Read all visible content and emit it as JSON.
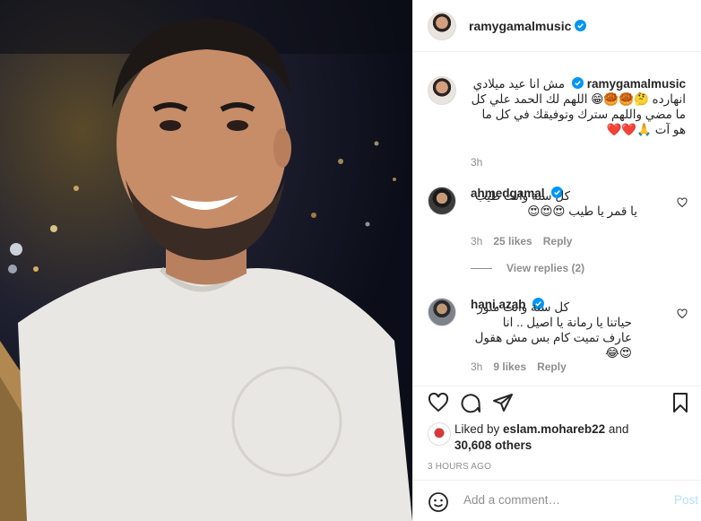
{
  "post": {
    "author": "ramygamalmusic",
    "accent_color": "#0095f6",
    "photo_description_icon": "portrait-photo"
  },
  "caption": {
    "username": "ramygamalmusic",
    "text": "مش انا عيد ميلادي انهارده 🤔🥮🥮😁 اللهم لك الحمد علي كل ما مضي واللهم سترك وتوفيقك في كل ما هو آت 🙏❤️❤️",
    "time": "3h"
  },
  "comments": [
    {
      "username": "ahmedgamal",
      "verified": true,
      "text": "كل سنة وانت طيب يا قمر يا طيب 😍😍😍",
      "time": "3h",
      "likes": "25 likes",
      "reply": "Reply"
    },
    {
      "username": "hani.azab",
      "verified": true,
      "text": "كل سنة وانت منور حياتنا يا رمانة يا اصيل .. انا عارف تميت كام بس مش هقول 😍😂",
      "time": "3h",
      "likes": "9 likes",
      "reply": "Reply"
    }
  ],
  "view_replies": "View replies (2)",
  "liked_by": {
    "prefix": "Liked by ",
    "user": "eslam.mohareb22",
    "middle": " and",
    "count": "30,608 others"
  },
  "posted_ago": "3 HOURS AGO",
  "add_comment": {
    "placeholder": "Add a comment…",
    "post_label": "Post"
  }
}
